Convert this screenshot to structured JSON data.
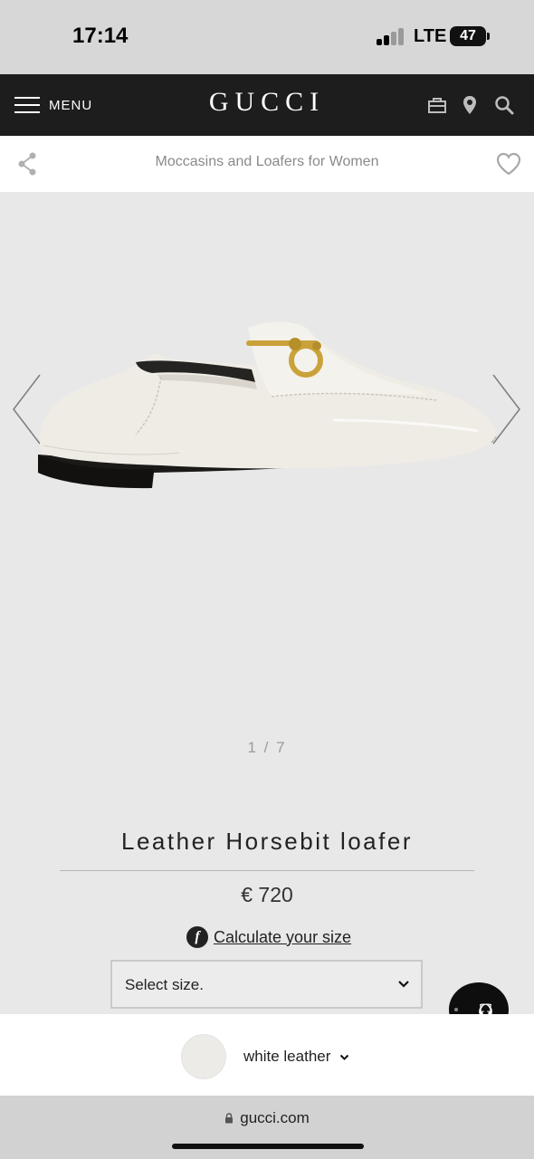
{
  "status_bar": {
    "time": "17:14",
    "network": "LTE",
    "battery": "47",
    "icons": [
      "signal-icon",
      "battery-icon"
    ]
  },
  "header": {
    "menu_label": "MENU",
    "logo": "GUCCI",
    "icons": [
      "menu-icon",
      "shopping-bag-icon",
      "location-pin-icon",
      "search-icon"
    ]
  },
  "subheader": {
    "category": "Moccasins and Loafers for Women",
    "icons": [
      "share-icon",
      "heart-icon"
    ]
  },
  "gallery": {
    "pager": "1 / 7",
    "image_semantic": "white leather loafer with gold horsebit",
    "icons": [
      "chevron-left-icon",
      "chevron-right-icon"
    ]
  },
  "product": {
    "name": "Leather Horsebit loafer",
    "price": "€ 720",
    "calc_size_label": "Calculate your size",
    "size_placeholder": "Select size.",
    "icons": [
      "fit-finder-icon",
      "chevron-down-icon"
    ]
  },
  "chat": {
    "icons": [
      "gucci-gg-chat-icon"
    ]
  },
  "color": {
    "label": "white leather",
    "swatch_color": "#ecebe7",
    "icons": [
      "chevron-down-icon"
    ]
  },
  "browser": {
    "url": "gucci.com",
    "icons": [
      "lock-icon"
    ]
  },
  "colors": {
    "header_bg": "#1d1d1d",
    "page_bg": "#e8e8e8",
    "hardware_gold": "#c9a23a"
  }
}
